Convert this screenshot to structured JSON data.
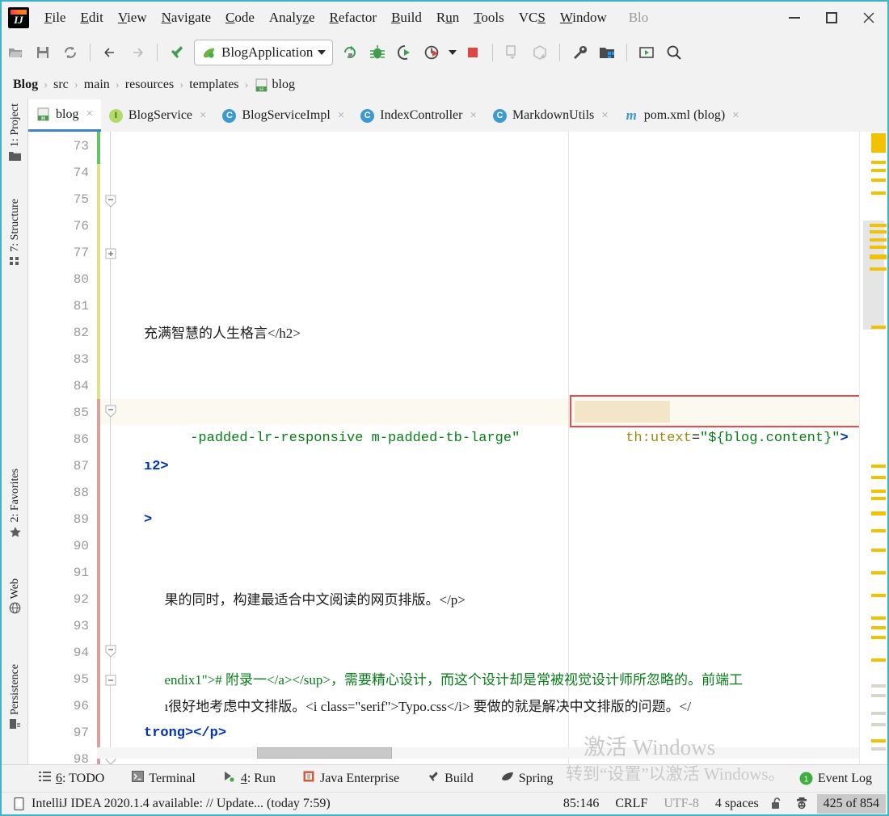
{
  "window": {
    "app_logo": "intellij-logo",
    "title_truncated": "Blo",
    "minimize": "minimize",
    "maximize": "maximize",
    "close": "close"
  },
  "menubar": {
    "items": [
      {
        "label": "File",
        "mnemonic": "F"
      },
      {
        "label": "Edit",
        "mnemonic": "E"
      },
      {
        "label": "View",
        "mnemonic": "V"
      },
      {
        "label": "Navigate",
        "mnemonic": "N"
      },
      {
        "label": "Code",
        "mnemonic": "C"
      },
      {
        "label": "Analyze",
        "mnemonic": "z"
      },
      {
        "label": "Refactor",
        "mnemonic": "R"
      },
      {
        "label": "Build",
        "mnemonic": "B"
      },
      {
        "label": "Run",
        "mnemonic": "u"
      },
      {
        "label": "Tools",
        "mnemonic": "T"
      },
      {
        "label": "VCS",
        "mnemonic": "S"
      },
      {
        "label": "Window",
        "mnemonic": "W"
      }
    ]
  },
  "toolbar": {
    "open_label": "open-project-icon",
    "save_label": "save-all-icon",
    "sync_label": "synchronize-icon",
    "back_label": "navigate-back-icon",
    "forward_label": "navigate-forward-icon",
    "build_label": "build-hammer-icon",
    "run_config": "BlogApplication",
    "rerun_label": "rerun-icon",
    "debug_label": "debug-icon",
    "coverage_label": "run-with-coverage-icon",
    "profile_label": "profile-icon",
    "stop_label": "stop-icon",
    "update_label": "update-project-icon",
    "commit_label": "commit-icon",
    "settings_label": "settings-wrench-icon",
    "project_structure_label": "project-structure-icon",
    "run_anything_label": "run-anything-icon",
    "search_label": "search-everywhere-icon"
  },
  "breadcrumb": {
    "items": [
      "Blog",
      "src",
      "main",
      "resources",
      "templates",
      "blog"
    ],
    "separator": "›",
    "leaf_icon": "html-file-icon"
  },
  "left_tool_strip": {
    "items": [
      {
        "label": "1: Project",
        "icon": "project-folder-icon"
      },
      {
        "label": "7: Structure",
        "icon": "structure-icon"
      },
      {
        "label": "2: Favorites",
        "icon": "star-icon"
      },
      {
        "label": "Web",
        "icon": "web-globe-icon"
      },
      {
        "label": "Persistence",
        "icon": "persistence-icon"
      }
    ]
  },
  "editor_tabs": [
    {
      "label": "blog",
      "icon": "html-file-icon",
      "icon_letter": "H",
      "icon_color": "#4a9e4a",
      "active": true,
      "close": "×"
    },
    {
      "label": "BlogService",
      "icon": "interface-icon",
      "icon_letter": "I",
      "icon_color": "#8bc34a",
      "active": false,
      "close": "×"
    },
    {
      "label": "BlogServiceImpl",
      "icon": "class-icon",
      "icon_letter": "C",
      "icon_color": "#3d9ad1",
      "active": false,
      "close": "×"
    },
    {
      "label": "IndexController",
      "icon": "class-icon",
      "icon_letter": "C",
      "icon_color": "#3d9ad1",
      "active": false,
      "close": "×"
    },
    {
      "label": "MarkdownUtils",
      "icon": "class-icon",
      "icon_letter": "C",
      "icon_color": "#3d9ad1",
      "active": false,
      "close": "×"
    },
    {
      "label": "pom.xml (blog)",
      "icon": "maven-icon",
      "icon_letter": "m",
      "icon_color": "#3d9ad1",
      "active": false,
      "close": "×"
    }
  ],
  "editor": {
    "line_numbers": [
      "73",
      "74",
      "75",
      "76",
      "77",
      "80",
      "81",
      "82",
      "83",
      "84",
      "85",
      "86",
      "87",
      "88",
      "89",
      "90",
      "91",
      "92",
      "93",
      "94",
      "95",
      "96",
      "97",
      "98"
    ],
    "active_line": "85",
    "lines": {
      "l82": "充满智慧的人生格言</h2>",
      "l85_a": "-padded-lr-responsive m-padded-tb-large\" ",
      "l85_attr": "th:utext",
      "l85_eq": "=",
      "l85_val": "\"${blog.content}\"",
      "l85_end": ">",
      "l87": "ı2>",
      "l89": ">",
      "l91": "果的同时，构建最适合中文阅读的网页排版。</p>",
      "l94": "endix1\"># 附录一</a></sup>，需要精心设计，而这个设计却是常被视觉设计师所忽略的。前端工",
      "l95": "ı很好地考虑中文排版。<i class=\"serif\">Typo.css</i> 要做的就是解决中文排版的问题。</",
      "l97": "trong></p>"
    },
    "fold_icons": [
      "collapse-fold-icon",
      "expand-fold-icon",
      "collapse-fold-icon",
      "collapse-fold-icon",
      "collapse-fold-icon",
      "collapse-fold-icon"
    ]
  },
  "bottom_toolwindows": [
    {
      "label": "6: TODO",
      "mnemonic": "6",
      "icon": "todo-list-icon"
    },
    {
      "label": "Terminal",
      "icon": "terminal-icon"
    },
    {
      "label": "4: Run",
      "mnemonic": "4",
      "icon": "run-play-icon"
    },
    {
      "label": "Java Enterprise",
      "icon": "java-enterprise-icon"
    },
    {
      "label": "Build",
      "icon": "build-hammer-icon"
    },
    {
      "label": "Spring",
      "icon": "spring-leaf-icon"
    },
    {
      "label": "Event Log",
      "icon": "event-log-icon",
      "badge": "1"
    }
  ],
  "statusbar": {
    "notice_icon": "ide-update-icon",
    "notice": "IntelliJ IDEA 2020.1.4 available: // Update... (today 7:59)",
    "caret_position": "85:146",
    "line_separator": "CRLF",
    "encoding": "UTF-8",
    "indent": "4 spaces",
    "lock_icon": "unlocked-padlock-icon",
    "inspector_icon": "hector-inspection-icon",
    "memory": "425 of 854"
  },
  "watermark": {
    "line1": "激活 Windows",
    "line2": "转到“设置”以激活 Windows。"
  },
  "colors": {
    "accent_teal": "#3fb3c8",
    "tab_active_underline": "#4083c9",
    "selection_border": "#ed4a4a",
    "selection_fill": "#f3e6c8",
    "tag": "#0033b3",
    "attr_name": "#9e880d",
    "attr_value": "#067d17",
    "marker_yellow": "#f2c200",
    "change_green": "#62c462",
    "change_yellow": "#dfe08a",
    "change_red": "#d9a0a0"
  }
}
